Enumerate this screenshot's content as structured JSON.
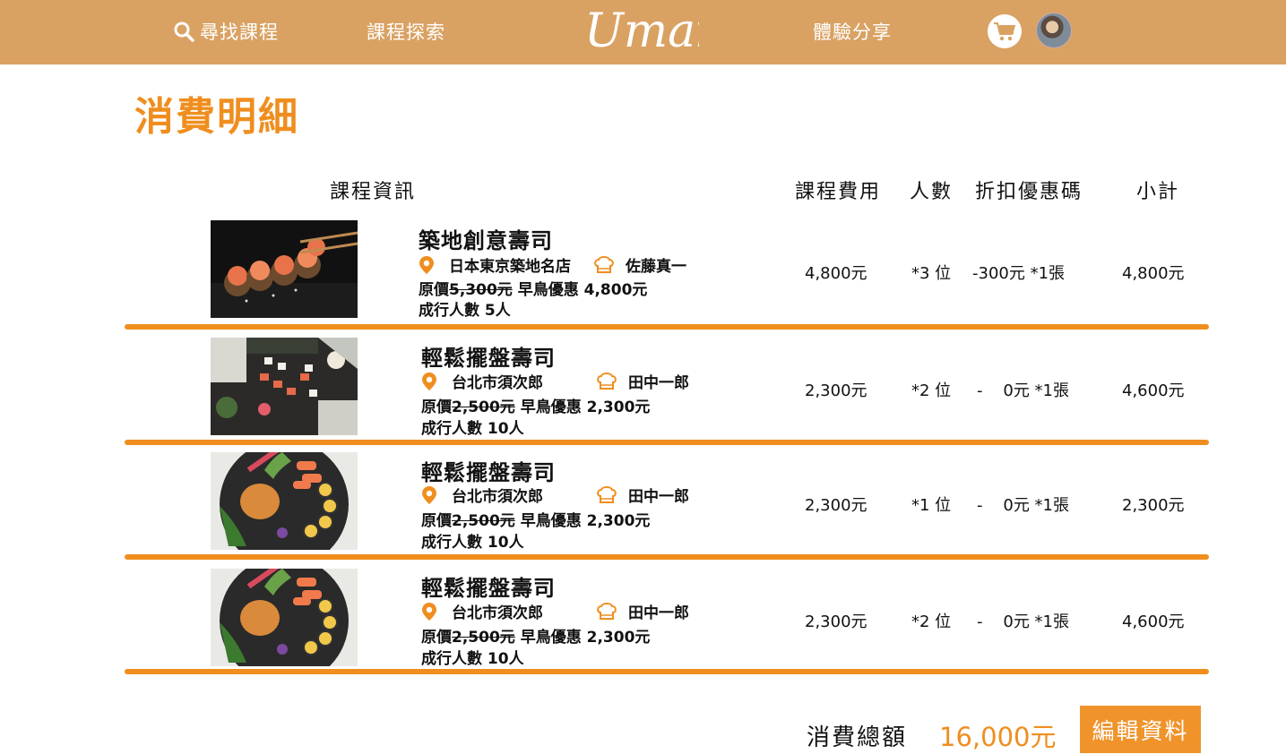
{
  "header": {
    "search_label": "尋找課程",
    "explore_label": "課程探索",
    "logo_text": "Umai",
    "share_label": "體驗分享",
    "brand_color": "#d9a263"
  },
  "page_title": "消費明細",
  "columns": {
    "info": "課程資訊",
    "fee": "課程費用",
    "people": "人數",
    "coupon": "折扣優惠碼",
    "subtotal": "小計"
  },
  "rows": [
    {
      "name": "築地創意壽司",
      "location": "日本東京築地名店",
      "chef": "佐藤真一",
      "price_prefix": "原價",
      "original_price": "5,300元",
      "early_bird": "早鳥優惠 4,800元",
      "min_people": "成行人數 5人",
      "fee": "4,800元",
      "people": "*3  位",
      "coupon": "-300元 *1張",
      "subtotal": "4,800元",
      "image": "sushi-rolls-chopsticks"
    },
    {
      "name": "輕鬆擺盤壽司",
      "location": "台北市須次郎",
      "chef": "田中一郎",
      "price_prefix": "原價",
      "original_price": "2,500元",
      "early_bird": "早鳥優惠 2,300元",
      "min_people": "成行人數 10人",
      "fee": "2,300元",
      "people": "*2  位",
      "coupon": "-    0元 *1張",
      "subtotal": "4,600元",
      "image": "sushi-platter-table"
    },
    {
      "name": "輕鬆擺盤壽司",
      "location": "台北市須次郎",
      "chef": "田中一郎",
      "price_prefix": "原價",
      "original_price": "2,500元",
      "early_bird": "早鳥優惠 2,300元",
      "min_people": "成行人數 10人",
      "fee": "2,300元",
      "people": "*1  位",
      "coupon": "-    0元 *1張",
      "subtotal": "2,300元",
      "image": "sushi-plate-salmon"
    },
    {
      "name": "輕鬆擺盤壽司",
      "location": "台北市須次郎",
      "chef": "田中一郎",
      "price_prefix": "原價",
      "original_price": "2,500元",
      "early_bird": "早鳥優惠 2,300元",
      "min_people": "成行人數 10人",
      "fee": "2,300元",
      "people": "*2  位",
      "coupon": "-    0元 *1張",
      "subtotal": "4,600元",
      "image": "sushi-plate-salmon"
    }
  ],
  "footer": {
    "total_label": "消費總額",
    "total_value": "16,000元",
    "edit_label": "編輯資料"
  },
  "accent_color": "#ef8e1f"
}
